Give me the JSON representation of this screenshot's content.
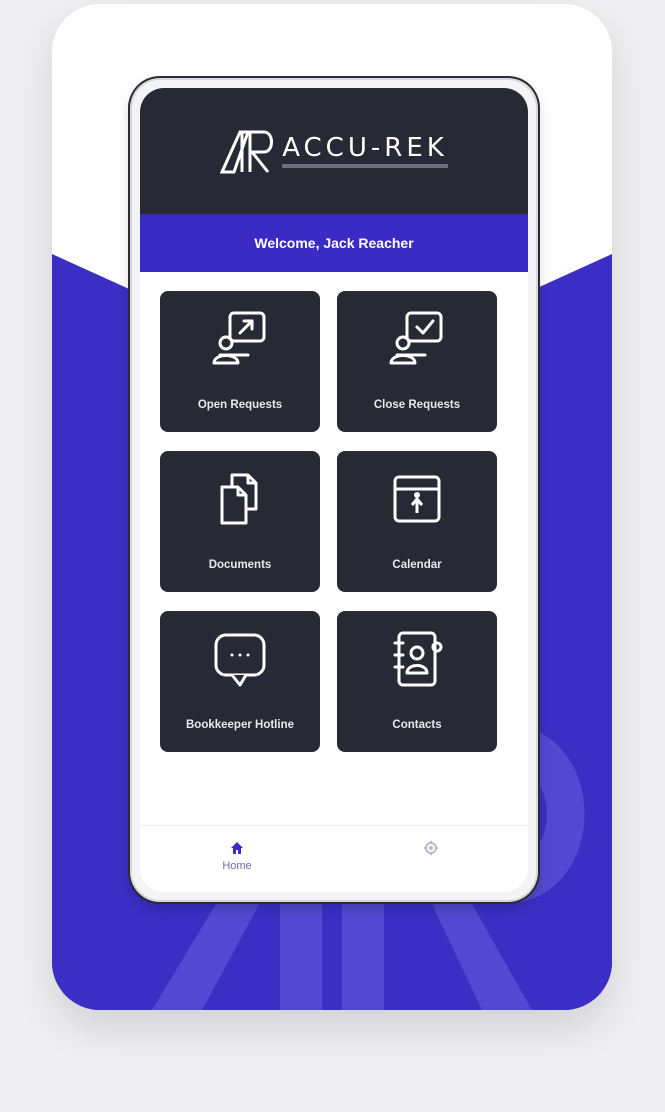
{
  "app": {
    "brand": "ACCU-REK",
    "welcome": "Welcome, Jack Reacher"
  },
  "tiles": [
    {
      "label": "Open Requests",
      "icon": "open-request-icon"
    },
    {
      "label": "Close Requests",
      "icon": "close-request-icon"
    },
    {
      "label": "Documents",
      "icon": "documents-icon"
    },
    {
      "label": "Calendar",
      "icon": "calendar-icon"
    },
    {
      "label": "Bookkeeper Hotline",
      "icon": "chat-bubble-icon"
    },
    {
      "label": "Contacts",
      "icon": "contacts-book-icon"
    }
  ],
  "nav": {
    "home_label": "Home",
    "items": [
      {
        "name": "home",
        "icon": "home-icon",
        "active": true
      },
      {
        "name": "settings",
        "icon": "gear-icon",
        "active": false
      }
    ]
  },
  "colors": {
    "accent": "#3a2bc4",
    "dark": "#272a34",
    "card_purple": "#3b2ec5"
  }
}
